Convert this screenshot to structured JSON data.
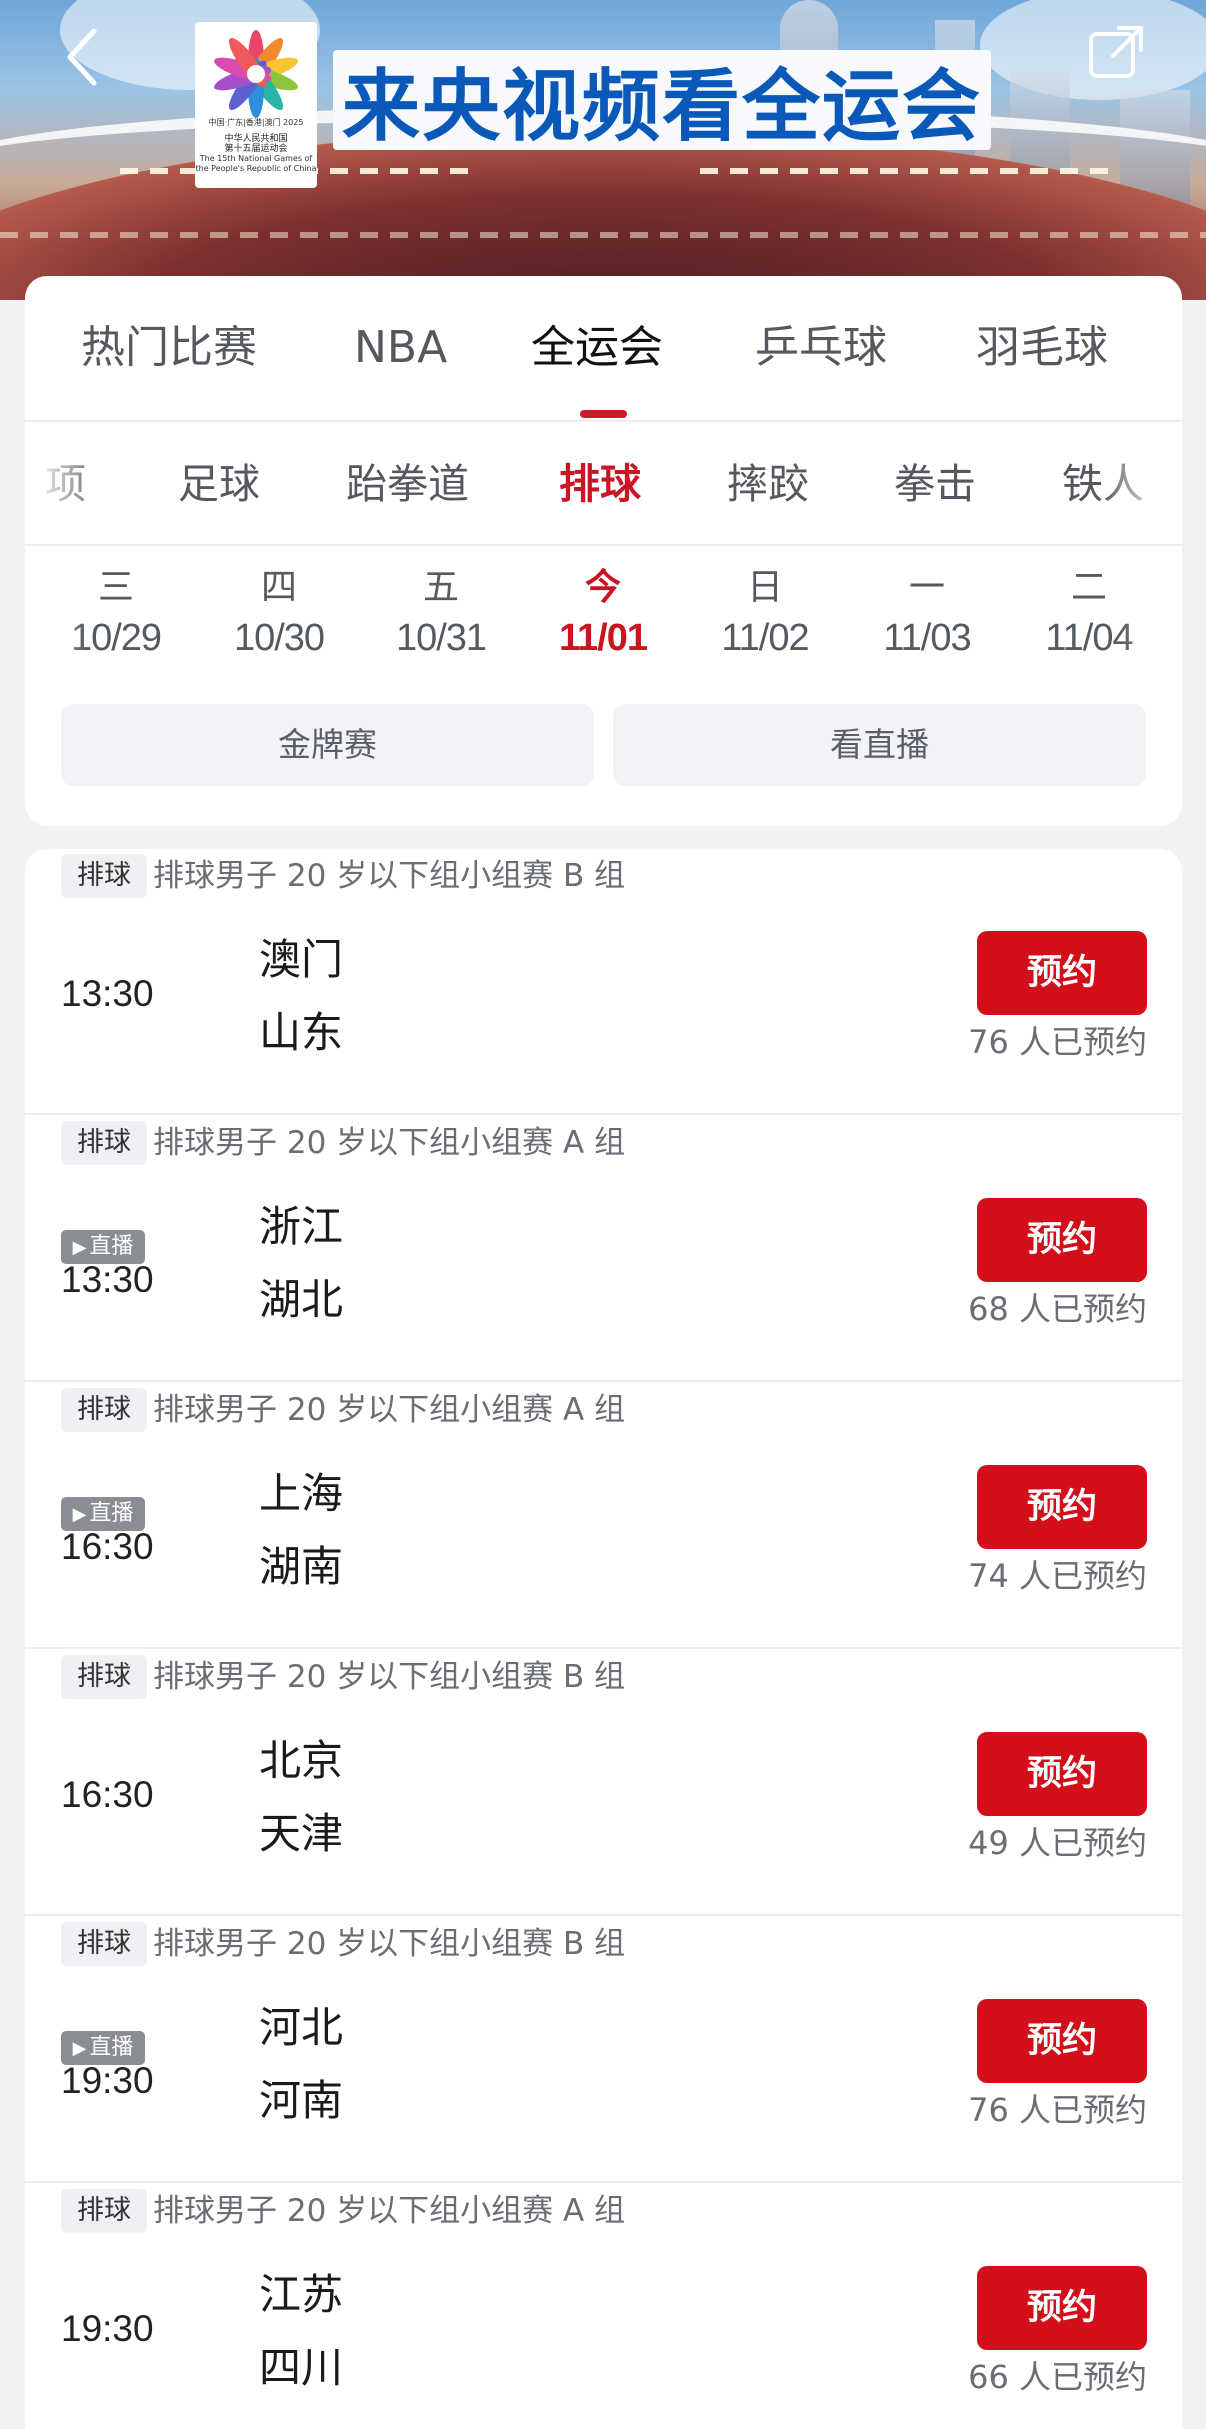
{
  "header": {
    "banner_title": "来央视频看全运会",
    "logo_line_1": "中国·广东|香港|澳门 2025",
    "logo_line_2": "中华人民共和国",
    "logo_line_3": "第十五届运动会",
    "logo_line_4": "The 15th National Games of",
    "logo_line_5": "the People's Republic of China",
    "back_icon": "chevron-left-icon",
    "share_icon": "share-icon"
  },
  "main_tabs": [
    {
      "label": "热门比赛",
      "active": false
    },
    {
      "label": "NBA",
      "active": false
    },
    {
      "label": "全运会",
      "active": true
    },
    {
      "label": "乒乓球",
      "active": false
    },
    {
      "label": "羽毛球",
      "active": false
    }
  ],
  "sport_tabs": [
    {
      "label": "项",
      "active": false
    },
    {
      "label": "足球",
      "active": false
    },
    {
      "label": "跆拳道",
      "active": false
    },
    {
      "label": "排球",
      "active": true
    },
    {
      "label": "摔跤",
      "active": false
    },
    {
      "label": "拳击",
      "active": false
    },
    {
      "label": "铁人",
      "active": false
    }
  ],
  "dates": [
    {
      "weekday": "三",
      "date": "10/29",
      "active": false
    },
    {
      "weekday": "四",
      "date": "10/30",
      "active": false
    },
    {
      "weekday": "五",
      "date": "10/31",
      "active": false
    },
    {
      "weekday": "今",
      "date": "11/01",
      "active": true
    },
    {
      "weekday": "日",
      "date": "11/02",
      "active": false
    },
    {
      "weekday": "一",
      "date": "11/03",
      "active": false
    },
    {
      "weekday": "二",
      "date": "11/04",
      "active": false
    }
  ],
  "filters": {
    "gold_label": "金牌赛",
    "live_label": "看直播"
  },
  "matches": [
    {
      "tag": "排球",
      "title": "排球男子 20 岁以下组小组赛 B 组",
      "live": false,
      "live_label": "",
      "time": "13:30",
      "team_a": "澳门",
      "team_b": "山东",
      "button": "预约",
      "count": "76 人已预约"
    },
    {
      "tag": "排球",
      "title": "排球男子 20 岁以下组小组赛 A 组",
      "live": true,
      "live_label": "直播",
      "time": "13:30",
      "team_a": "浙江",
      "team_b": "湖北",
      "button": "预约",
      "count": "68 人已预约"
    },
    {
      "tag": "排球",
      "title": "排球男子 20 岁以下组小组赛 A 组",
      "live": true,
      "live_label": "直播",
      "time": "16:30",
      "team_a": "上海",
      "team_b": "湖南",
      "button": "预约",
      "count": "74 人已预约"
    },
    {
      "tag": "排球",
      "title": "排球男子 20 岁以下组小组赛 B 组",
      "live": false,
      "live_label": "",
      "time": "16:30",
      "team_a": "北京",
      "team_b": "天津",
      "button": "预约",
      "count": "49 人已预约"
    },
    {
      "tag": "排球",
      "title": "排球男子 20 岁以下组小组赛 B 组",
      "live": true,
      "live_label": "直播",
      "time": "19:30",
      "team_a": "河北",
      "team_b": "河南",
      "button": "预约",
      "count": "76 人已预约"
    },
    {
      "tag": "排球",
      "title": "排球男子 20 岁以下组小组赛 A 组",
      "live": false,
      "live_label": "",
      "time": "19:30",
      "team_a": "江苏",
      "team_b": "四川",
      "button": "预约",
      "count": "66 人已预约"
    }
  ],
  "colors": {
    "accent_red": "#d20f1a",
    "title_blue": "#0a58b8",
    "page_bg": "#f2f2f4"
  }
}
